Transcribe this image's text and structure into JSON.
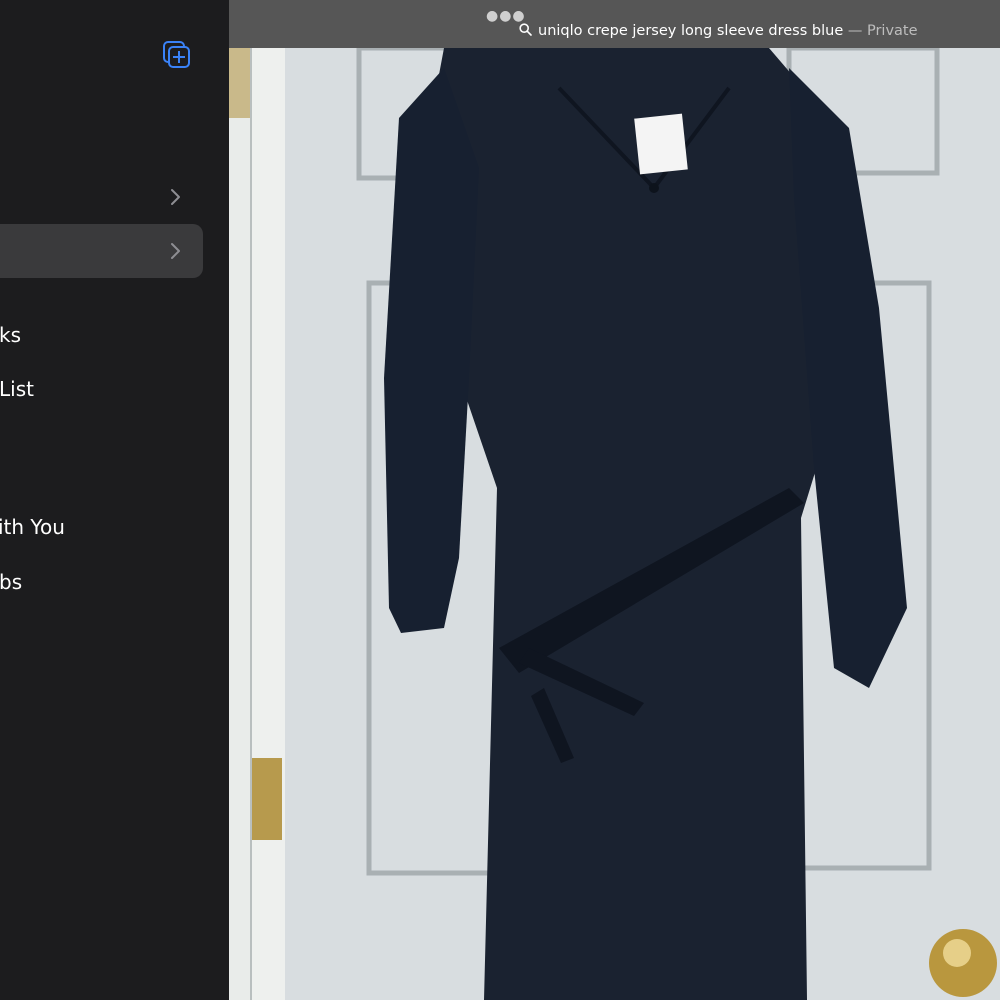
{
  "sidebar": {
    "new_tab_group_icon": "new-tab-group-icon",
    "items": [
      {
        "label": ""
      },
      {
        "label": ""
      },
      {
        "label": "ks"
      },
      {
        "label": "List"
      },
      {
        "label": "ith You"
      },
      {
        "label": "bs"
      }
    ]
  },
  "addressbar": {
    "more_icon": "more-dots-icon",
    "search_icon": "search-icon",
    "query": "uniqlo crepe jersey long sleeve dress blue",
    "separator": " — ",
    "mode": "Private"
  },
  "colors": {
    "accent": "#3a82f7",
    "sidebar_bg": "#1c1c1e",
    "selected_bg": "#3a3a3c",
    "addressbar_bg": "#565656",
    "dress": "#1a2230",
    "door": "#d6dcdf"
  }
}
